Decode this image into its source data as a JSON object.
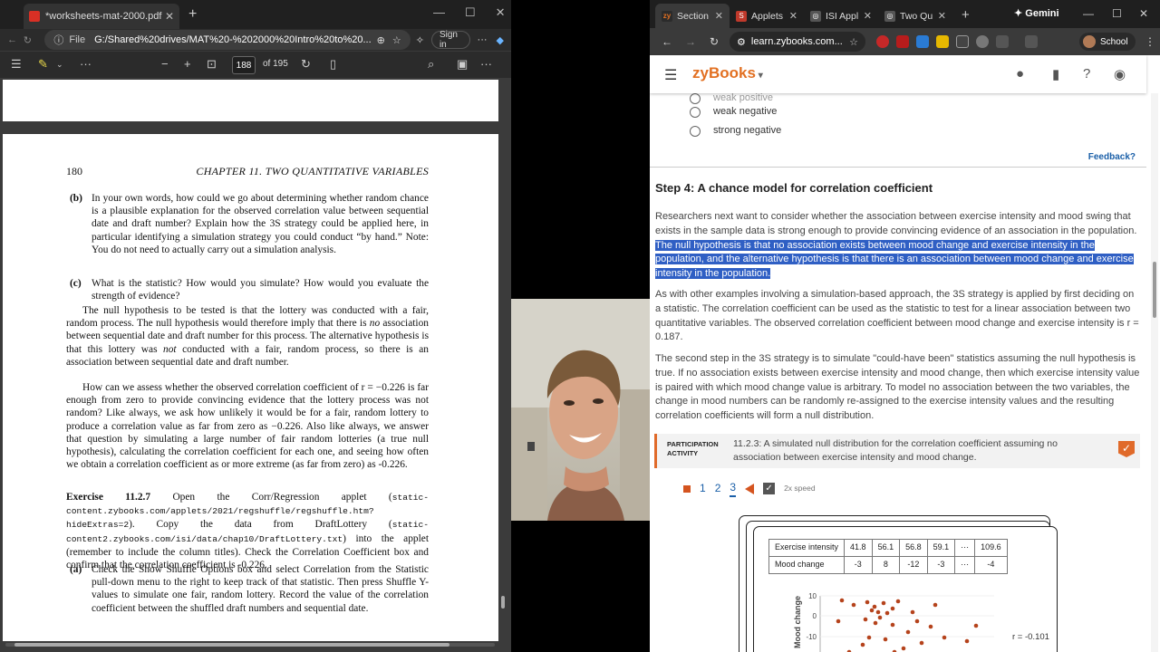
{
  "pdf": {
    "tab_title": "*worksheets-mat-2000.pdf",
    "address_label": "File",
    "url": "G:/Shared%20drives/MAT%20-%202000%20Intro%20to%20...",
    "signin": "Sign in",
    "page_current": "188",
    "page_of": "of 195",
    "header_page_num": "180",
    "header_chapter": "CHAPTER 11.  TWO QUANTITATIVE VARIABLES",
    "b_label": "(b)",
    "b_text": "In your own words, how could we go about determining whether random chance is a plausible explanation for the observed correlation value between sequential date and draft number? Explain how the 3S strategy could be applied here, in particular identifying a simulation strategy you could conduct “by hand.” Note: You do not need to actually carry out a simulation analysis.",
    "c_label": "(c)",
    "c_text": "What is the statistic? How would you simulate? How would you evaluate the strength of evidence?",
    "null_p1": "The null hypothesis to be tested is that the lottery was conducted with a fair, random process. The null hypothesis would therefore imply that there is",
    "null_p1_no": "no",
    "null_p1_b": "association between sequential date and draft number for this process. The alternative hypothesis is that this lottery was",
    "null_p1_not": "not",
    "null_p1_c": "conducted with a fair, random process, so there is an association between sequential date and draft number.",
    "assess_p": "How can we assess whether the observed correlation coefficient of r = −0.226 is far enough from zero to provide convincing evidence that the lottery process was not random? Like always, we ask how unlikely it would be for a fair, random lottery to produce a correlation value as far from zero as −0.226. Also like always, we answer that question by simulating a large number of fair random lotteries (a true null hypothesis), calculating the correlation coefficient for each one, and seeing how often we obtain a correlation coefficient as or more extreme (as far from zero) as -0.226.",
    "ex_label": "Exercise 11.2.7",
    "ex_text_a": "Open the Corr/Regression applet (",
    "ex_url1": "static-content.zybooks.com/applets/2021/regshuffle/regshuffle.htm?hideExtras=2",
    "ex_text_b": "). Copy the data from DraftLottery (",
    "ex_url2": "static-content2.zybooks.com/isi/data/chap10/DraftLottery.txt",
    "ex_text_c": ") into the applet (remember to include the column titles). Check the Correlation Coefficient box and confirm that the correlation coefficient is -0.226.",
    "a_label": "(a)",
    "a_text": "Check the Show Shuffle Options box and select Correlation from the Statistic pull-down menu to the right to keep track of that statistic. Then press Shuffle Y-values to simulate one fair, random lottery. Record the value of the correlation coefficient between the shuffled draft numbers and sequential date."
  },
  "browser": {
    "tabs": [
      {
        "label": "Section",
        "icon": "zy",
        "color": "#2b2b2b"
      },
      {
        "label": "Applets",
        "icon": "S",
        "color": "#c0392b"
      },
      {
        "label": "ISI Appl",
        "icon": "globe-icon",
        "color": "#555555"
      },
      {
        "label": "Two Qu",
        "icon": "globe-icon",
        "color": "#555555"
      }
    ],
    "gemini": "✦ Gemini",
    "url": "learn.zybooks.com...",
    "profile": "School"
  },
  "zy": {
    "logo": "zyBooks",
    "options": [
      "weak positive",
      "weak negative",
      "strong negative"
    ],
    "feedback": "Feedback?",
    "step_heading": "Step 4: A chance model for correlation coefficient",
    "p1_lead": "Researchers next want to consider whether the association between exercise intensity and mood swing that exists in the sample data is strong enough to provide convincing evidence of an association in the population.",
    "p1_hl": "The null hypothesis is that no association exists between mood change and exercise intensity in the population, and the alternative hypothesis is that there is an association between mood change and exercise intensity in the population.",
    "p2": "As with other examples involving a simulation-based approach, the 3S strategy is applied by first deciding on a statistic. The correlation coefficient can be used as the statistic to test for a linear association between two quantitative variables. The observed correlation coefficient between mood change and exercise intensity is r = 0.187.",
    "p3": "The second step in the 3S strategy is to simulate \"could-have been\" statistics assuming the null hypothesis is true. If no association exists between exercise intensity and mood change, then which exercise intensity value is paired with which mood change value is arbitrary. To model no association between the two variables, the change in mood numbers can be randomly re-assigned to the exercise intensity values and the resulting correlation coefficients will form a null distribution.",
    "pa_tag": "PARTICIPATION ACTIVITY",
    "pa_title": "11.2.3: A simulated null distribution for the correlation coefficient assuming no association between exercise intensity and mood change.",
    "steps": [
      "1",
      "2",
      "3"
    ],
    "speed": "2x speed",
    "table": {
      "row1": [
        "Exercise intensity",
        "41.8",
        "56.1",
        "56.8",
        "59.1",
        "···",
        "109.6"
      ],
      "row2": [
        "Mood change",
        "-3",
        "8",
        "-12",
        "-3",
        "···",
        "-4"
      ]
    },
    "plot_ylabel": "Mood change",
    "plot_ticks": [
      "10",
      "0",
      "-10"
    ],
    "plot_r": "r = -0.101"
  }
}
